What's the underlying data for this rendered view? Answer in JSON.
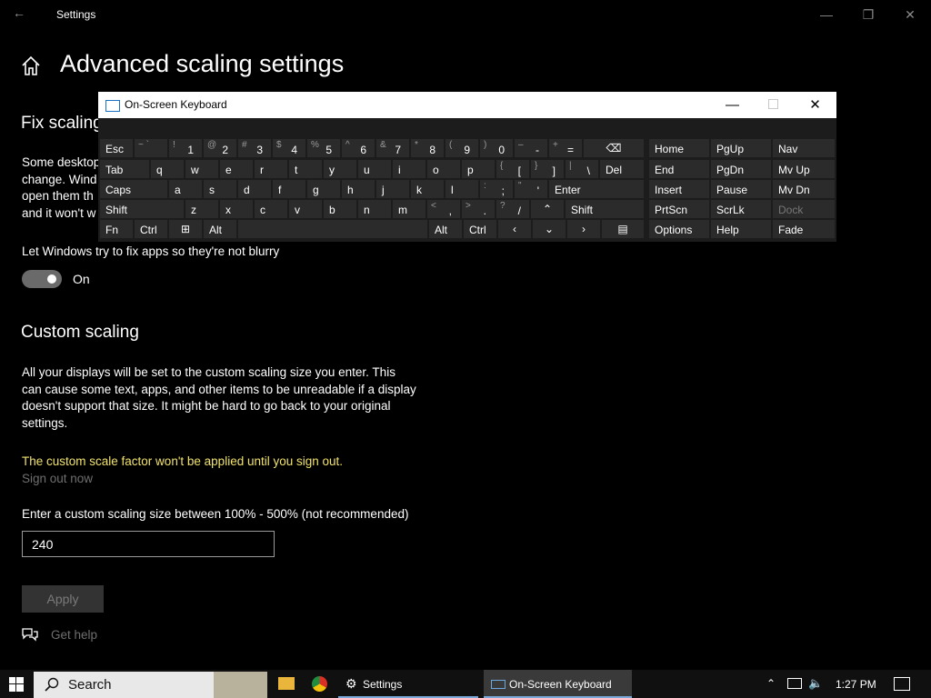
{
  "settings": {
    "window_title": "Settings",
    "page_title": "Advanced scaling settings",
    "fix_scaling": {
      "heading": "Fix scaling",
      "paragraph_lines": [
        "Some desktop",
        "change. Wind",
        "open them th",
        "and it won't w"
      ],
      "toggle_label": "Let Windows try to fix apps so they're not blurry",
      "toggle_state": "On"
    },
    "custom_scaling": {
      "heading": "Custom scaling",
      "paragraph_lines": [
        "All your displays will be set to the custom scaling size you enter. This",
        "can cause some text, apps, and other items to be unreadable if a display",
        "doesn't support that size. It might be hard to go back to your original",
        "settings."
      ],
      "warning": "The custom scale factor won't be applied until you sign out.",
      "sign_out_link": "Sign out now",
      "input_label": "Enter a custom scaling size between 100% - 500% (not recommended)",
      "input_value": "240",
      "apply_label": "Apply"
    },
    "get_help": "Get help"
  },
  "osk": {
    "title": "On-Screen Keyboard",
    "keys": {
      "esc": "Esc",
      "tab": "Tab",
      "caps": "Caps",
      "shift": "Shift",
      "fn": "Fn",
      "ctrl": "Ctrl",
      "alt": "Alt",
      "del": "Del",
      "enter": "Enter",
      "shift_r": "Shift",
      "alt_r": "Alt",
      "ctrl_r": "Ctrl",
      "home": "Home",
      "pgup": "PgUp",
      "nav": "Nav",
      "end": "End",
      "pgdn": "PgDn",
      "mvup": "Mv Up",
      "insert": "Insert",
      "pause": "Pause",
      "mvdn": "Mv Dn",
      "prtscn": "PrtScn",
      "scrlk": "ScrLk",
      "dock": "Dock",
      "options": "Options",
      "help": "Help",
      "fade": "Fade"
    },
    "number_row": [
      {
        "shift": "~ `",
        "main": ""
      },
      {
        "shift": "!",
        "main": "1"
      },
      {
        "shift": "@",
        "main": "2"
      },
      {
        "shift": "#",
        "main": "3"
      },
      {
        "shift": "$",
        "main": "4"
      },
      {
        "shift": "%",
        "main": "5"
      },
      {
        "shift": "^",
        "main": "6"
      },
      {
        "shift": "&",
        "main": "7"
      },
      {
        "shift": "*",
        "main": "8"
      },
      {
        "shift": "(",
        "main": "9"
      },
      {
        "shift": ")",
        "main": "0"
      },
      {
        "shift": "–",
        "main": "-"
      },
      {
        "shift": "+",
        "main": "="
      }
    ],
    "row_q": [
      "q",
      "w",
      "e",
      "r",
      "t",
      "y",
      "u",
      "i",
      "o",
      "p"
    ],
    "row_q_extra": [
      {
        "shift": "{",
        "main": "["
      },
      {
        "shift": "}",
        "main": "]"
      },
      {
        "shift": "|",
        "main": "\\"
      }
    ],
    "row_a": [
      "a",
      "s",
      "d",
      "f",
      "g",
      "h",
      "j",
      "k",
      "l"
    ],
    "row_a_extra": [
      {
        "shift": ":",
        "main": ";"
      },
      {
        "shift": "\"",
        "main": "'"
      }
    ],
    "row_z": [
      "z",
      "x",
      "c",
      "v",
      "b",
      "n",
      "m"
    ],
    "row_z_extra": [
      {
        "shift": "<",
        "main": ","
      },
      {
        "shift": ">",
        "main": "."
      },
      {
        "shift": "?",
        "main": "/"
      }
    ]
  },
  "taskbar": {
    "search_placeholder": "Search",
    "settings_app": "Settings",
    "osk_app": "On-Screen Keyboard",
    "time": "1:27 PM"
  }
}
